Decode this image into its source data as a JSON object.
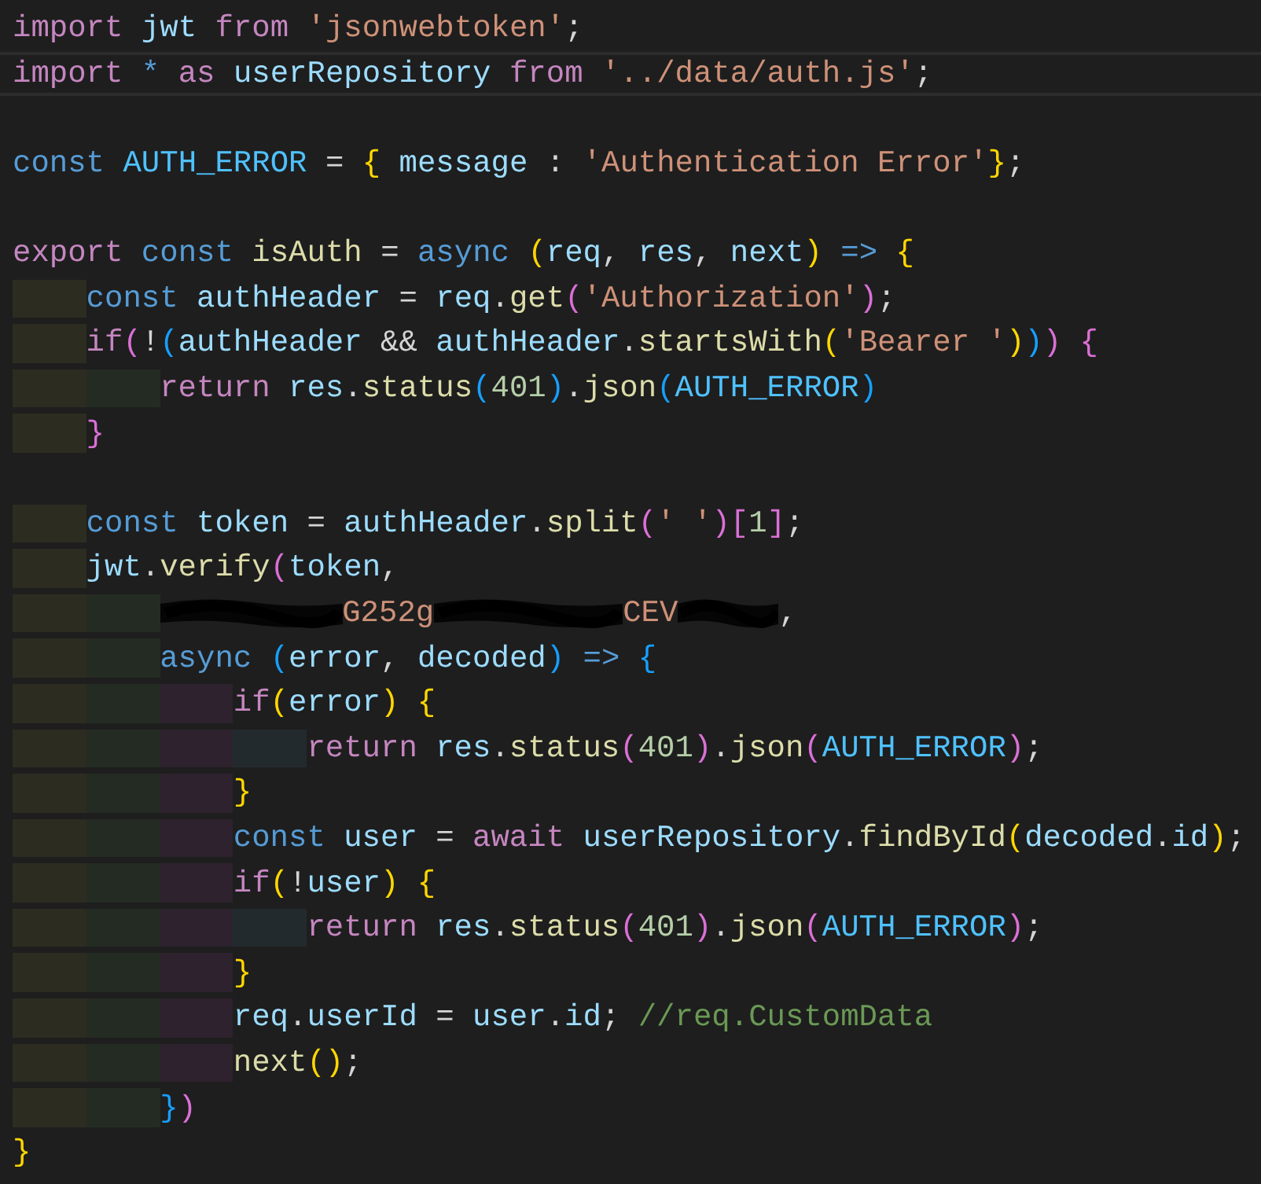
{
  "editor": {
    "lines": [
      {
        "kind": "code",
        "current": false,
        "tokens": [
          {
            "text": "import ",
            "kind": "kw"
          },
          {
            "text": "jwt ",
            "kind": "var"
          },
          {
            "text": "from ",
            "kind": "kw"
          },
          {
            "text": "'jsonwebtoken'",
            "kind": "str"
          },
          {
            "text": ";",
            "kind": "punct"
          }
        ]
      },
      {
        "kind": "code",
        "current": true,
        "tokens": [
          {
            "text": "import ",
            "kind": "kw"
          },
          {
            "text": "* ",
            "kind": "storage"
          },
          {
            "text": "as ",
            "kind": "kw"
          },
          {
            "text": "userRepository ",
            "kind": "var"
          },
          {
            "text": "from ",
            "kind": "kw"
          },
          {
            "text": "'../data/auth.js'",
            "kind": "str"
          },
          {
            "text": ";",
            "kind": "punct"
          }
        ]
      },
      {
        "kind": "blank",
        "current": false
      },
      {
        "kind": "code",
        "current": false,
        "tokens": [
          {
            "text": "const ",
            "kind": "storage"
          },
          {
            "text": "AUTH_ERROR ",
            "kind": "constant"
          },
          {
            "text": "= ",
            "kind": "punct"
          },
          {
            "text": "{",
            "kind": "b1"
          },
          {
            "text": " message ",
            "kind": "var"
          },
          {
            "text": ": ",
            "kind": "punct"
          },
          {
            "text": "'Authentication Error'",
            "kind": "str"
          },
          {
            "text": "}",
            "kind": "b1"
          },
          {
            "text": ";",
            "kind": "punct"
          }
        ]
      },
      {
        "kind": "blank",
        "current": false
      },
      {
        "kind": "code",
        "current": false,
        "tokens": [
          {
            "text": "export ",
            "kind": "kw"
          },
          {
            "text": "const ",
            "kind": "storage"
          },
          {
            "text": "isAuth ",
            "kind": "fn"
          },
          {
            "text": "= ",
            "kind": "punct"
          },
          {
            "text": "async ",
            "kind": "storage"
          },
          {
            "text": "(",
            "kind": "b1"
          },
          {
            "text": "req",
            "kind": "var"
          },
          {
            "text": ", ",
            "kind": "punct"
          },
          {
            "text": "res",
            "kind": "var"
          },
          {
            "text": ", ",
            "kind": "punct"
          },
          {
            "text": "next",
            "kind": "var"
          },
          {
            "text": ")",
            "kind": "b1"
          },
          {
            "text": " => ",
            "kind": "storage"
          },
          {
            "text": "{",
            "kind": "b1"
          }
        ],
        "children": [
          {
            "kind": "code",
            "current": false,
            "tokens": [
              {
                "text": "const ",
                "kind": "storage"
              },
              {
                "text": "authHeader ",
                "kind": "var"
              },
              {
                "text": "= ",
                "kind": "punct"
              },
              {
                "text": "req",
                "kind": "var"
              },
              {
                "text": ".",
                "kind": "punct"
              },
              {
                "text": "get",
                "kind": "fn"
              },
              {
                "text": "(",
                "kind": "b2"
              },
              {
                "text": "'Authorization'",
                "kind": "str"
              },
              {
                "text": ")",
                "kind": "b2"
              },
              {
                "text": ";",
                "kind": "punct"
              }
            ]
          },
          {
            "kind": "code",
            "current": false,
            "tokens": [
              {
                "text": "if",
                "kind": "kw"
              },
              {
                "text": "(",
                "kind": "b2"
              },
              {
                "text": "!",
                "kind": "punct"
              },
              {
                "text": "(",
                "kind": "b3"
              },
              {
                "text": "authHeader ",
                "kind": "var"
              },
              {
                "text": "&& ",
                "kind": "punct"
              },
              {
                "text": "authHeader",
                "kind": "var"
              },
              {
                "text": ".",
                "kind": "punct"
              },
              {
                "text": "startsWith",
                "kind": "fn"
              },
              {
                "text": "(",
                "kind": "b1"
              },
              {
                "text": "'Bearer '",
                "kind": "str"
              },
              {
                "text": ")",
                "kind": "b1"
              },
              {
                "text": ")",
                "kind": "b3"
              },
              {
                "text": ") ",
                "kind": "b2"
              },
              {
                "text": "{",
                "kind": "b2"
              }
            ],
            "children": [
              {
                "kind": "code",
                "current": false,
                "tokens": [
                  {
                    "text": "return ",
                    "kind": "kw"
                  },
                  {
                    "text": "res",
                    "kind": "var"
                  },
                  {
                    "text": ".",
                    "kind": "punct"
                  },
                  {
                    "text": "status",
                    "kind": "fn"
                  },
                  {
                    "text": "(",
                    "kind": "b3"
                  },
                  {
                    "text": "401",
                    "kind": "num"
                  },
                  {
                    "text": ")",
                    "kind": "b3"
                  },
                  {
                    "text": ".",
                    "kind": "punct"
                  },
                  {
                    "text": "json",
                    "kind": "fn"
                  },
                  {
                    "text": "(",
                    "kind": "b3"
                  },
                  {
                    "text": "AUTH_ERROR",
                    "kind": "constant"
                  },
                  {
                    "text": ")",
                    "kind": "b3"
                  }
                ]
              }
            ]
          },
          {
            "kind": "code",
            "current": false,
            "tokens": [
              {
                "text": "}",
                "kind": "b2"
              }
            ]
          },
          {
            "kind": "blank",
            "current": false
          },
          {
            "kind": "code",
            "current": false,
            "tokens": [
              {
                "text": "const ",
                "kind": "storage"
              },
              {
                "text": "token ",
                "kind": "var"
              },
              {
                "text": "= ",
                "kind": "punct"
              },
              {
                "text": "authHeader",
                "kind": "var"
              },
              {
                "text": ".",
                "kind": "punct"
              },
              {
                "text": "split",
                "kind": "fn"
              },
              {
                "text": "(",
                "kind": "b2"
              },
              {
                "text": "' '",
                "kind": "str"
              },
              {
                "text": ")",
                "kind": "b2"
              },
              {
                "text": "[",
                "kind": "b2"
              },
              {
                "text": "1",
                "kind": "num"
              },
              {
                "text": "]",
                "kind": "b2"
              },
              {
                "text": ";",
                "kind": "punct"
              }
            ]
          },
          {
            "kind": "code",
            "current": false,
            "tokens": [
              {
                "text": "jwt",
                "kind": "var"
              },
              {
                "text": ".",
                "kind": "punct"
              },
              {
                "text": "verify",
                "kind": "fn"
              },
              {
                "text": "(",
                "kind": "b2"
              },
              {
                "text": "token",
                "kind": "var"
              },
              {
                "text": ",",
                "kind": "punct"
              }
            ],
            "children": [
              {
                "kind": "code",
                "current": false,
                "tokens": [
                  {
                    "kind": "redacted"
                  },
                  {
                    "text": "G252g",
                    "kind": "str"
                  },
                  {
                    "kind": "redacted"
                  },
                  {
                    "text": "CEV",
                    "kind": "str"
                  },
                  {
                    "kind": "redacted"
                  },
                  {
                    "text": ",",
                    "kind": "punct"
                  }
                ]
              },
              {
                "kind": "code",
                "current": false,
                "tokens": [
                  {
                    "text": "async ",
                    "kind": "storage"
                  },
                  {
                    "text": "(",
                    "kind": "b3"
                  },
                  {
                    "text": "error",
                    "kind": "var"
                  },
                  {
                    "text": ", ",
                    "kind": "punct"
                  },
                  {
                    "text": "decoded",
                    "kind": "var"
                  },
                  {
                    "text": ")",
                    "kind": "b3"
                  },
                  {
                    "text": " => ",
                    "kind": "storage"
                  },
                  {
                    "text": "{",
                    "kind": "b3"
                  }
                ],
                "children": [
                  {
                    "kind": "code",
                    "current": false,
                    "tokens": [
                      {
                        "text": "if",
                        "kind": "kw"
                      },
                      {
                        "text": "(",
                        "kind": "b1"
                      },
                      {
                        "text": "error",
                        "kind": "var"
                      },
                      {
                        "text": ") ",
                        "kind": "b1"
                      },
                      {
                        "text": "{",
                        "kind": "b1"
                      }
                    ],
                    "children": [
                      {
                        "kind": "code",
                        "current": false,
                        "tokens": [
                          {
                            "text": "return ",
                            "kind": "kw"
                          },
                          {
                            "text": "res",
                            "kind": "var"
                          },
                          {
                            "text": ".",
                            "kind": "punct"
                          },
                          {
                            "text": "status",
                            "kind": "fn"
                          },
                          {
                            "text": "(",
                            "kind": "b2"
                          },
                          {
                            "text": "401",
                            "kind": "num"
                          },
                          {
                            "text": ")",
                            "kind": "b2"
                          },
                          {
                            "text": ".",
                            "kind": "punct"
                          },
                          {
                            "text": "json",
                            "kind": "fn"
                          },
                          {
                            "text": "(",
                            "kind": "b2"
                          },
                          {
                            "text": "AUTH_ERROR",
                            "kind": "constant"
                          },
                          {
                            "text": ")",
                            "kind": "b2"
                          },
                          {
                            "text": ";",
                            "kind": "punct"
                          }
                        ]
                      }
                    ]
                  },
                  {
                    "kind": "code",
                    "current": false,
                    "tokens": [
                      {
                        "text": "}",
                        "kind": "b1"
                      }
                    ]
                  },
                  {
                    "kind": "code",
                    "current": false,
                    "tokens": [
                      {
                        "text": "const ",
                        "kind": "storage"
                      },
                      {
                        "text": "user ",
                        "kind": "var"
                      },
                      {
                        "text": "= ",
                        "kind": "punct"
                      },
                      {
                        "text": "await ",
                        "kind": "kw"
                      },
                      {
                        "text": "userRepository",
                        "kind": "var"
                      },
                      {
                        "text": ".",
                        "kind": "punct"
                      },
                      {
                        "text": "findById",
                        "kind": "fn"
                      },
                      {
                        "text": "(",
                        "kind": "b1"
                      },
                      {
                        "text": "decoded",
                        "kind": "var"
                      },
                      {
                        "text": ".",
                        "kind": "punct"
                      },
                      {
                        "text": "id",
                        "kind": "var"
                      },
                      {
                        "text": ")",
                        "kind": "b1"
                      },
                      {
                        "text": ";",
                        "kind": "punct"
                      }
                    ]
                  },
                  {
                    "kind": "code",
                    "current": false,
                    "tokens": [
                      {
                        "text": "if",
                        "kind": "kw"
                      },
                      {
                        "text": "(",
                        "kind": "b1"
                      },
                      {
                        "text": "!",
                        "kind": "punct"
                      },
                      {
                        "text": "user",
                        "kind": "var"
                      },
                      {
                        "text": ") ",
                        "kind": "b1"
                      },
                      {
                        "text": "{",
                        "kind": "b1"
                      }
                    ],
                    "children": [
                      {
                        "kind": "code",
                        "current": false,
                        "tokens": [
                          {
                            "text": "return ",
                            "kind": "kw"
                          },
                          {
                            "text": "res",
                            "kind": "var"
                          },
                          {
                            "text": ".",
                            "kind": "punct"
                          },
                          {
                            "text": "status",
                            "kind": "fn"
                          },
                          {
                            "text": "(",
                            "kind": "b2"
                          },
                          {
                            "text": "401",
                            "kind": "num"
                          },
                          {
                            "text": ")",
                            "kind": "b2"
                          },
                          {
                            "text": ".",
                            "kind": "punct"
                          },
                          {
                            "text": "json",
                            "kind": "fn"
                          },
                          {
                            "text": "(",
                            "kind": "b2"
                          },
                          {
                            "text": "AUTH_ERROR",
                            "kind": "constant"
                          },
                          {
                            "text": ")",
                            "kind": "b2"
                          },
                          {
                            "text": ";",
                            "kind": "punct"
                          }
                        ]
                      }
                    ]
                  },
                  {
                    "kind": "code",
                    "current": false,
                    "tokens": [
                      {
                        "text": "}",
                        "kind": "b1"
                      }
                    ]
                  },
                  {
                    "kind": "code",
                    "current": false,
                    "tokens": [
                      {
                        "text": "req",
                        "kind": "var"
                      },
                      {
                        "text": ".",
                        "kind": "punct"
                      },
                      {
                        "text": "userId ",
                        "kind": "var"
                      },
                      {
                        "text": "= ",
                        "kind": "punct"
                      },
                      {
                        "text": "user",
                        "kind": "var"
                      },
                      {
                        "text": ".",
                        "kind": "punct"
                      },
                      {
                        "text": "id",
                        "kind": "var"
                      },
                      {
                        "text": "; ",
                        "kind": "punct"
                      },
                      {
                        "text": "//req.CustomData",
                        "kind": "comment"
                      }
                    ]
                  },
                  {
                    "kind": "code",
                    "current": false,
                    "tokens": [
                      {
                        "text": "next",
                        "kind": "fn"
                      },
                      {
                        "text": "(",
                        "kind": "b1"
                      },
                      {
                        "text": ")",
                        "kind": "b1"
                      },
                      {
                        "text": ";",
                        "kind": "punct"
                      }
                    ]
                  }
                ]
              },
              {
                "kind": "code",
                "current": false,
                "tokens": [
                  {
                    "text": "}",
                    "kind": "b3"
                  },
                  {
                    "text": ")",
                    "kind": "b2"
                  }
                ]
              }
            ]
          }
        ]
      },
      {
        "kind": "code",
        "current": false,
        "tokens": [
          {
            "text": "}",
            "kind": "b1"
          }
        ]
      }
    ]
  }
}
